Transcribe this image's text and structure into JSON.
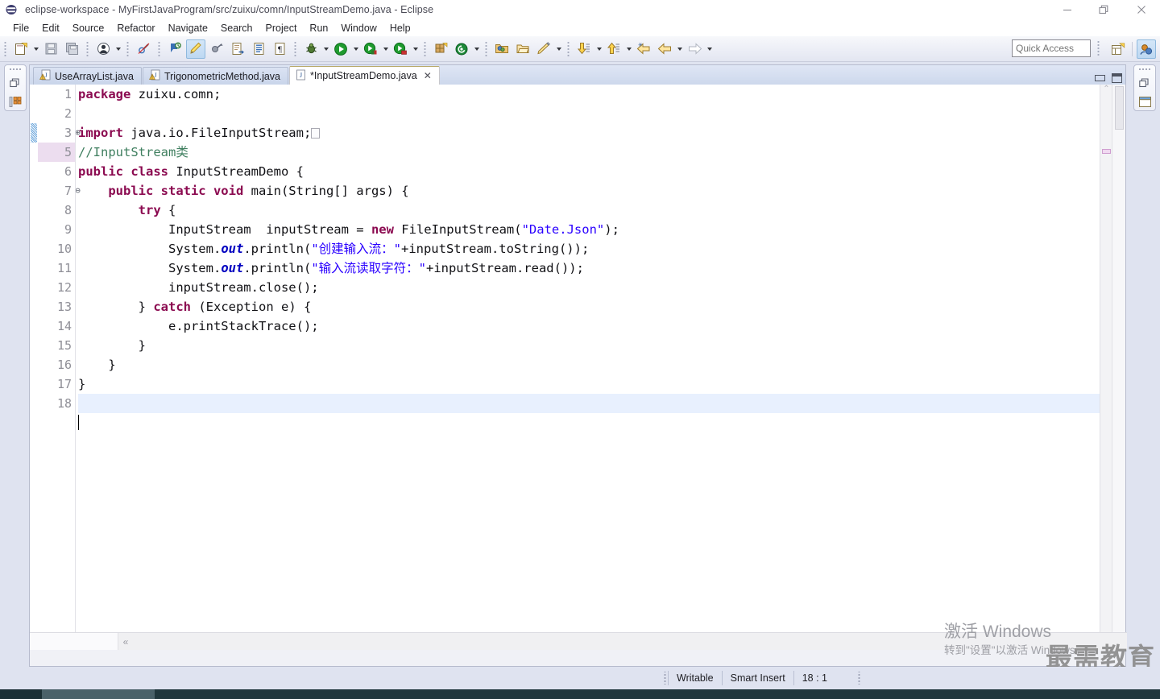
{
  "window": {
    "title": "eclipse-workspace - MyFirstJavaProgram/src/zuixu/comn/InputStreamDemo.java - Eclipse",
    "app_icon": "eclipse-icon",
    "controls": [
      {
        "name": "minimize-window-button",
        "glyph": "minimize-icon"
      },
      {
        "name": "restore-window-button",
        "glyph": "restore-icon"
      },
      {
        "name": "close-window-button",
        "glyph": "close-icon"
      }
    ]
  },
  "menubar": {
    "items": [
      {
        "label": "File"
      },
      {
        "label": "Edit"
      },
      {
        "label": "Source"
      },
      {
        "label": "Refactor"
      },
      {
        "label": "Navigate"
      },
      {
        "label": "Search"
      },
      {
        "label": "Project"
      },
      {
        "label": "Run"
      },
      {
        "label": "Window"
      },
      {
        "label": "Help"
      }
    ]
  },
  "toolbar": {
    "quick_access_placeholder": "Quick Access",
    "quick_access_value": "",
    "buttons": [
      {
        "name": "new-wizard-button",
        "icon": "new-file-icon"
      },
      {
        "name": "save-button",
        "icon": "save-icon"
      },
      {
        "name": "save-all-button",
        "icon": "save-all-icon"
      },
      {
        "name": "user-button",
        "icon": "person-icon"
      },
      {
        "name": "skip-breakpoints-button",
        "icon": "skip-breakpoints-icon"
      },
      {
        "name": "next-annotation-button",
        "icon": "next-annotation-icon"
      },
      {
        "name": "toggle-mark-occurrences-button",
        "icon": "highlighter-icon"
      },
      {
        "name": "previous-annotation-button",
        "icon": "previous-annotation-icon"
      },
      {
        "name": "open-type-button",
        "icon": "open-type-icon"
      },
      {
        "name": "open-task-button",
        "icon": "open-task-icon"
      },
      {
        "name": "pilcrow-button",
        "icon": "pilcrow-icon"
      },
      {
        "name": "debug-button",
        "icon": "bug-icon"
      },
      {
        "name": "run-button",
        "icon": "run-icon"
      },
      {
        "name": "external-tools-button",
        "icon": "run-external-icon"
      },
      {
        "name": "coverage-button",
        "icon": "coverage-icon"
      },
      {
        "name": "new-java-class-button",
        "icon": "new-class-icon"
      },
      {
        "name": "new-annotation-button",
        "icon": "new-annotation-icon"
      },
      {
        "name": "open-resource-button",
        "icon": "open-folder-icon"
      },
      {
        "name": "open-package-button",
        "icon": "package-icon"
      },
      {
        "name": "search-button",
        "icon": "pencil-icon"
      },
      {
        "name": "previous-edit-button",
        "icon": "down-arrow-icon"
      },
      {
        "name": "next-edit-button",
        "icon": "up-arrow-icon"
      },
      {
        "name": "back-history-button",
        "icon": "back-star-icon"
      },
      {
        "name": "back-button",
        "icon": "back-arrow-icon"
      },
      {
        "name": "forward-button",
        "icon": "forward-arrow-icon"
      }
    ],
    "perspective_buttons": [
      {
        "name": "open-perspective-button",
        "icon": "open-perspective-icon"
      },
      {
        "name": "java-perspective-button",
        "icon": "java-perspective-icon"
      }
    ]
  },
  "trim_left": {
    "restore_icon": "restore-view-icon",
    "view_icon": "package-explorer-icon"
  },
  "trim_right": {
    "restore_icon": "restore-view-icon",
    "view_icon": "outline-view-icon"
  },
  "editor": {
    "tabs": [
      {
        "label": "UseArrayList.java",
        "icon": "java-warning-icon",
        "selected": false,
        "dirty": false
      },
      {
        "label": "TrigonometricMethod.java",
        "icon": "java-warning-icon",
        "selected": false,
        "dirty": false
      },
      {
        "label": "*InputStreamDemo.java",
        "icon": "java-file-icon",
        "selected": true,
        "dirty": true,
        "close_glyph": "✕"
      }
    ],
    "tab_controls": [
      {
        "name": "minimize-editor-button",
        "icon": "minimize-icon"
      },
      {
        "name": "maximize-editor-button",
        "icon": "maximize-icon"
      }
    ],
    "scroll_left_glyph": "«",
    "scroll_down_glyph": "⌄",
    "overview_top_glyph": "⌃",
    "lines": [
      {
        "num": "1",
        "fold": "",
        "highlight": false,
        "current": false,
        "changed": false,
        "tokens": [
          {
            "t": "package ",
            "c": "kw"
          },
          {
            "t": "zuixu.comn;",
            "c": ""
          }
        ]
      },
      {
        "num": "2",
        "fold": "",
        "highlight": false,
        "current": false,
        "changed": false,
        "tokens": [
          {
            "t": "",
            "c": ""
          }
        ]
      },
      {
        "num": "3",
        "fold": "⊕",
        "highlight": false,
        "current": false,
        "changed": true,
        "tokens": [
          {
            "t": "import ",
            "c": "kw"
          },
          {
            "t": "java.io.FileInputStream;",
            "c": ""
          },
          {
            "t": "⬚",
            "c": "collapsed"
          }
        ]
      },
      {
        "num": "5",
        "fold": "",
        "highlight": true,
        "current": false,
        "changed": false,
        "tokens": [
          {
            "t": "//InputStream类",
            "c": "cm"
          }
        ]
      },
      {
        "num": "6",
        "fold": "",
        "highlight": false,
        "current": false,
        "changed": false,
        "tokens": [
          {
            "t": "public class ",
            "c": "kw"
          },
          {
            "t": "InputStreamDemo {",
            "c": ""
          }
        ]
      },
      {
        "num": "7",
        "fold": "⊖",
        "highlight": false,
        "current": false,
        "changed": false,
        "tokens": [
          {
            "t": "    ",
            "c": ""
          },
          {
            "t": "public static void ",
            "c": "kw"
          },
          {
            "t": "main(String[] args) {",
            "c": ""
          }
        ]
      },
      {
        "num": "8",
        "fold": "",
        "highlight": false,
        "current": false,
        "changed": false,
        "tokens": [
          {
            "t": "        ",
            "c": ""
          },
          {
            "t": "try",
            "c": "kw"
          },
          {
            "t": " {",
            "c": ""
          }
        ]
      },
      {
        "num": "9",
        "fold": "",
        "highlight": false,
        "current": false,
        "changed": false,
        "tokens": [
          {
            "t": "            InputStream  inputStream = ",
            "c": ""
          },
          {
            "t": "new",
            "c": "kw"
          },
          {
            "t": " FileInputStream(",
            "c": ""
          },
          {
            "t": "\"Date.Json\"",
            "c": "st"
          },
          {
            "t": ");",
            "c": ""
          }
        ]
      },
      {
        "num": "10",
        "fold": "",
        "highlight": false,
        "current": false,
        "changed": false,
        "tokens": [
          {
            "t": "            System.",
            "c": ""
          },
          {
            "t": "out",
            "c": "fld-static"
          },
          {
            "t": ".println(",
            "c": ""
          },
          {
            "t": "\"创建输入流：\"",
            "c": "st"
          },
          {
            "t": "+inputStream.toString());",
            "c": ""
          }
        ]
      },
      {
        "num": "11",
        "fold": "",
        "highlight": false,
        "current": false,
        "changed": false,
        "tokens": [
          {
            "t": "            System.",
            "c": ""
          },
          {
            "t": "out",
            "c": "fld-static"
          },
          {
            "t": ".println(",
            "c": ""
          },
          {
            "t": "\"输入流读取字符：\"",
            "c": "st"
          },
          {
            "t": "+inputStream.read());",
            "c": ""
          }
        ]
      },
      {
        "num": "12",
        "fold": "",
        "highlight": false,
        "current": false,
        "changed": false,
        "tokens": [
          {
            "t": "            inputStream.close();",
            "c": ""
          }
        ]
      },
      {
        "num": "13",
        "fold": "",
        "highlight": false,
        "current": false,
        "changed": false,
        "tokens": [
          {
            "t": "        } ",
            "c": ""
          },
          {
            "t": "catch",
            "c": "kw"
          },
          {
            "t": " (Exception e) {",
            "c": ""
          }
        ]
      },
      {
        "num": "14",
        "fold": "",
        "highlight": false,
        "current": false,
        "changed": false,
        "tokens": [
          {
            "t": "            e.printStackTrace();",
            "c": ""
          }
        ]
      },
      {
        "num": "15",
        "fold": "",
        "highlight": false,
        "current": false,
        "changed": false,
        "tokens": [
          {
            "t": "        }",
            "c": ""
          }
        ]
      },
      {
        "num": "16",
        "fold": "",
        "highlight": false,
        "current": false,
        "changed": false,
        "tokens": [
          {
            "t": "    }",
            "c": ""
          }
        ]
      },
      {
        "num": "17",
        "fold": "",
        "highlight": false,
        "current": false,
        "changed": false,
        "tokens": [
          {
            "t": "}",
            "c": ""
          }
        ]
      },
      {
        "num": "18",
        "fold": "",
        "highlight": false,
        "current": true,
        "changed": false,
        "tokens": [
          {
            "t": "",
            "c": ""
          }
        ]
      }
    ]
  },
  "statusbar": {
    "writable": "Writable",
    "insert_mode": "Smart Insert",
    "position": "18 : 1"
  },
  "watermark": {
    "line1": "激活 Windows",
    "line2": "转到\"设置\"以激活 Windows。"
  },
  "brand": {
    "text": "最需教育",
    "badge_icon": "rss-icon"
  },
  "colors": {
    "keyword": "#8b0a50",
    "string": "#2a00ff",
    "comment": "#3f7f5f",
    "static_field": "#0000c0",
    "current_line": "#e8f0fe",
    "highlight_line": "#ecddef",
    "chrome": "#dfe3f0",
    "taskbar": "#21373d"
  }
}
